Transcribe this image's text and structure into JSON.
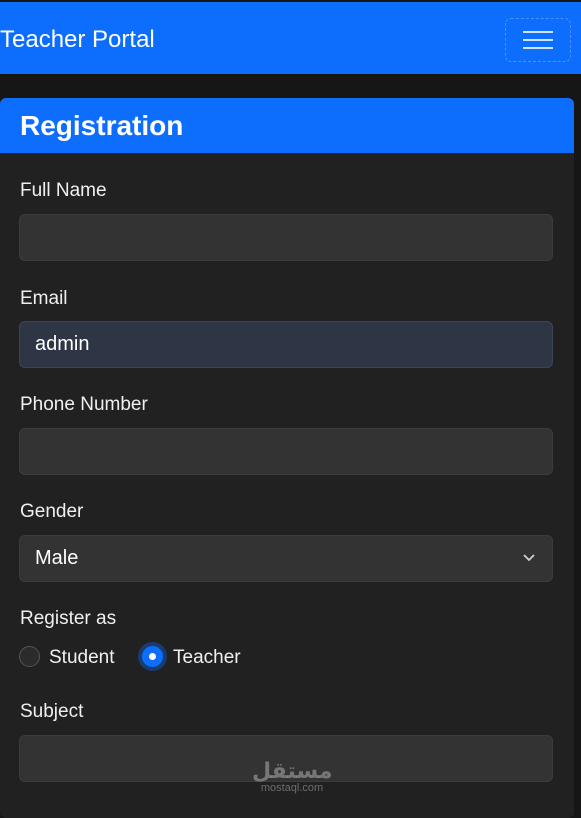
{
  "navbar": {
    "brand": "Teacher Portal",
    "toggle_icon": "hamburger-icon"
  },
  "form": {
    "title": "Registration",
    "full_name": {
      "label": "Full Name",
      "value": ""
    },
    "email": {
      "label": "Email",
      "value": "admin"
    },
    "phone": {
      "label": "Phone Number",
      "value": ""
    },
    "gender": {
      "label": "Gender",
      "selected": "Male"
    },
    "register_as": {
      "label": "Register as",
      "options": [
        "Student",
        "Teacher"
      ],
      "selected": "Teacher"
    },
    "subject": {
      "label": "Subject",
      "value": ""
    }
  },
  "watermark": {
    "arabic": "مستقل",
    "latin": "mostaql.com"
  },
  "colors": {
    "primary": "#0d6efd",
    "background": "#161616",
    "card": "#212121",
    "input": "#333333"
  }
}
